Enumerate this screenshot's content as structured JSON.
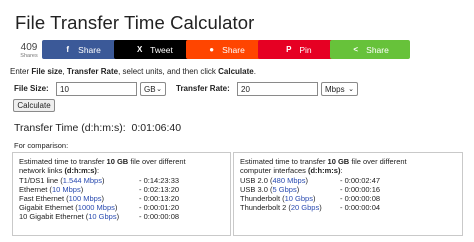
{
  "title": "File Transfer Time Calculator",
  "share": {
    "count": "409",
    "count_label": "Shares",
    "buttons": [
      {
        "label": "Share",
        "icon": "f",
        "color": "#3b5998",
        "icon_name": "facebook-icon"
      },
      {
        "label": "Tweet",
        "icon": "X",
        "color": "#000000",
        "icon_name": "x-icon"
      },
      {
        "label": "Share",
        "icon": "●",
        "color": "#ff4500",
        "icon_name": "reddit-icon"
      },
      {
        "label": "Pin",
        "icon": "P",
        "color": "#e60023",
        "icon_name": "pinterest-icon"
      },
      {
        "label": "Share",
        "icon": "<",
        "color": "#67c23a",
        "icon_name": "share-icon"
      }
    ]
  },
  "intro": {
    "p1": "Enter ",
    "b1": "File size",
    "p2": ", ",
    "b2": "Transfer Rate",
    "p3": ", select units, and then click ",
    "b3": "Calculate",
    "p4": "."
  },
  "form": {
    "file_size_label": "File Size:",
    "file_size_value": "10",
    "file_size_unit": "GB",
    "rate_label": "Transfer Rate:",
    "rate_value": "20",
    "rate_unit": "Mbps",
    "calculate_label": "Calculate"
  },
  "result": {
    "label": "Transfer Time (d:h:m:s):",
    "value": "0:01:06:40"
  },
  "comparison_label": "For comparison:",
  "left_panel": {
    "head1": "Estimated time to transfer ",
    "head_bold": "10 GB",
    "head2": " file over different",
    "head3": "network links ",
    "head3_bold": "(d:h:m:s)",
    "head3_end": ":",
    "rows": [
      {
        "name": "T1/DS1 line (",
        "rate": "1.544 Mbps",
        "close": ")",
        "value": "- 0:14:23:33"
      },
      {
        "name": "Ethernet (",
        "rate": "10 Mbps",
        "close": ")",
        "value": "- 0:02:13:20"
      },
      {
        "name": "Fast Ethernet (",
        "rate": "100 Mbps",
        "close": ")",
        "value": "- 0:00:13:20"
      },
      {
        "name": "Gigabit Ethernet (",
        "rate": "1000 Mbps",
        "close": ")",
        "value": "- 0:00:01:20"
      },
      {
        "name": "10 Gigabit Ethernet (",
        "rate": "10 Gbps",
        "close": ")",
        "value": "- 0:00:00:08"
      }
    ]
  },
  "right_panel": {
    "head1": "Estimated time to transfer ",
    "head_bold": "10 GB",
    "head2": " file over different",
    "head3": "computer interfaces ",
    "head3_bold": "(d:h:m:s)",
    "head3_end": ":",
    "rows": [
      {
        "name": "USB 2.0 (",
        "rate": "480 Mbps",
        "close": ")",
        "value": "- 0:00:02:47"
      },
      {
        "name": "USB 3.0 (",
        "rate": "5 Gbps",
        "close": ")",
        "value": "- 0:00:00:16"
      },
      {
        "name": "Thunderbolt (",
        "rate": "10 Gbps",
        "close": ")",
        "value": "- 0:00:00:08"
      },
      {
        "name": "Thunderbolt 2 (",
        "rate": "20 Gbps",
        "close": ")",
        "value": "- 0:00:00:04"
      }
    ]
  }
}
